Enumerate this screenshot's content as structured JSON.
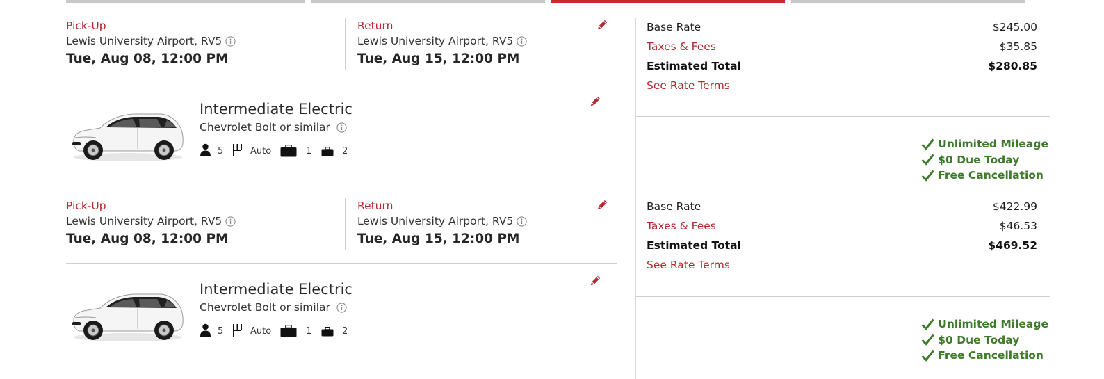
{
  "progress": {
    "steps": 4,
    "active_step": 3
  },
  "bookings": [
    {
      "pickup": {
        "label": "Pick-Up",
        "location": "Lewis University Airport, RV5",
        "datetime": "Tue, Aug 08, 12:00 PM"
      },
      "return": {
        "label": "Return",
        "location": "Lewis University Airport, RV5",
        "datetime": "Tue, Aug 15, 12:00 PM"
      },
      "vehicle": {
        "class_name": "Intermediate Electric",
        "model": "Chevrolet Bolt or similar",
        "passengers": "5",
        "transmission": "Auto",
        "large_bags": "1",
        "small_bags": "2"
      },
      "rates": {
        "base_rate_label": "Base Rate",
        "base_rate": "$245.00",
        "taxes_label": "Taxes & Fees",
        "taxes": "$35.85",
        "total_label": "Estimated Total",
        "total": "$280.85",
        "terms_link": "See Rate Terms"
      },
      "perks": [
        "Unlimited Mileage",
        "$0 Due Today",
        "Free Cancellation"
      ]
    },
    {
      "pickup": {
        "label": "Pick-Up",
        "location": "Lewis University Airport, RV5",
        "datetime": "Tue, Aug 08, 12:00 PM"
      },
      "return": {
        "label": "Return",
        "location": "Lewis University Airport, RV5",
        "datetime": "Tue, Aug 15, 12:00 PM"
      },
      "vehicle": {
        "class_name": "Intermediate Electric",
        "model": "Chevrolet Bolt or similar",
        "passengers": "5",
        "transmission": "Auto",
        "large_bags": "1",
        "small_bags": "2"
      },
      "rates": {
        "base_rate_label": "Base Rate",
        "base_rate": "$422.99",
        "taxes_label": "Taxes & Fees",
        "taxes": "$46.53",
        "total_label": "Estimated Total",
        "total": "$469.52",
        "terms_link": "See Rate Terms"
      },
      "perks": [
        "Unlimited Mileage",
        "$0 Due Today",
        "Free Cancellation"
      ]
    }
  ],
  "icons": {
    "edit": "pencil-icon",
    "info": "info-icon",
    "passengers": "person-icon",
    "transmission": "gear-shift-icon",
    "large_bags": "suitcase-icon",
    "small_bags": "bag-icon",
    "perk": "checkmark-icon"
  },
  "colors": {
    "accent": "#b52a33",
    "progress_active": "#d02630",
    "progress_inactive": "#c8c8c8",
    "perk_green": "#3d7a2a"
  }
}
